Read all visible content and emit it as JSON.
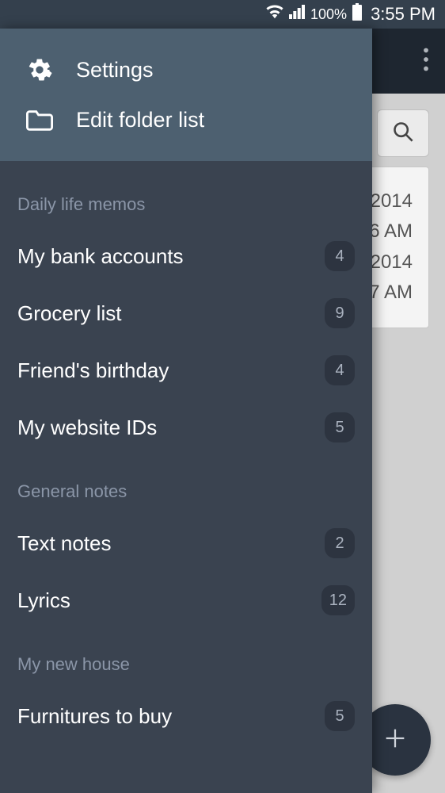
{
  "status": {
    "battery": "100%",
    "time": "3:55 PM"
  },
  "drawer": {
    "header": [
      {
        "icon": "gear",
        "label": "Settings"
      },
      {
        "icon": "folder",
        "label": "Edit folder list"
      }
    ],
    "sections": [
      {
        "title": "Daily life memos",
        "items": [
          {
            "label": "My bank accounts",
            "count": "4"
          },
          {
            "label": "Grocery list",
            "count": "9"
          },
          {
            "label": "Friend's birthday",
            "count": "4"
          },
          {
            "label": "My website IDs",
            "count": "5"
          }
        ]
      },
      {
        "title": "General notes",
        "items": [
          {
            "label": "Text notes",
            "count": "2"
          },
          {
            "label": "Lyrics",
            "count": "12"
          }
        ]
      },
      {
        "title": "My new house",
        "items": [
          {
            "label": "Furnitures to buy",
            "count": "5"
          }
        ]
      }
    ]
  },
  "background": {
    "card_lines": [
      "2014",
      "6 AM",
      "2014",
      "7 AM"
    ]
  }
}
